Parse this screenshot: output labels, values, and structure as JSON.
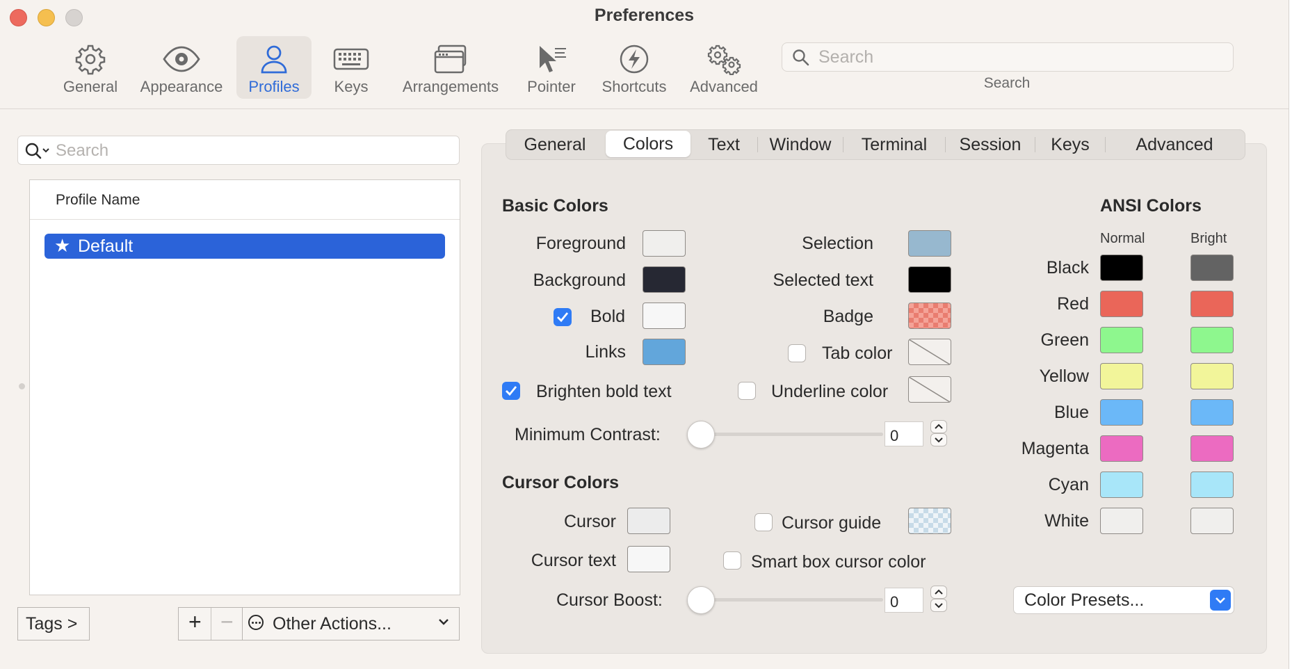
{
  "window": {
    "title": "Preferences"
  },
  "toolbar": {
    "items": [
      {
        "label": "General",
        "icon": "gear-icon"
      },
      {
        "label": "Appearance",
        "icon": "eye-icon"
      },
      {
        "label": "Profiles",
        "icon": "person-icon",
        "active": true
      },
      {
        "label": "Keys",
        "icon": "keyboard-icon"
      },
      {
        "label": "Arrangements",
        "icon": "window-stack-icon"
      },
      {
        "label": "Pointer",
        "icon": "pointer-icon"
      },
      {
        "label": "Shortcuts",
        "icon": "lightning-icon"
      },
      {
        "label": "Advanced",
        "icon": "gears-icon"
      }
    ],
    "search_placeholder": "Search",
    "search_label": "Search"
  },
  "sidebar": {
    "search_placeholder": "Search",
    "list_header": "Profile Name",
    "profiles": [
      {
        "name": "Default",
        "selected": true
      }
    ],
    "tags_button": "Tags >",
    "add_symbol": "+",
    "remove_symbol": "−",
    "other_actions": "Other Actions..."
  },
  "tabs": [
    "General",
    "Colors",
    "Text",
    "Window",
    "Terminal",
    "Session",
    "Keys",
    "Advanced"
  ],
  "active_tab": "Colors",
  "basic_colors": {
    "title": "Basic Colors",
    "foreground": {
      "label": "Foreground",
      "color": "#f0efed"
    },
    "background": {
      "label": "Background",
      "color": "#262833"
    },
    "bold": {
      "label": "Bold",
      "color": "#f7f7f7",
      "checked": true
    },
    "links": {
      "label": "Links",
      "color": "#62a6db"
    },
    "brighten_bold": {
      "label": "Brighten bold text",
      "checked": true
    },
    "selection": {
      "label": "Selection",
      "color": "#97b8cf"
    },
    "selected_text": {
      "label": "Selected text",
      "color": "#000000"
    },
    "badge": {
      "label": "Badge",
      "color": "#e97d70"
    },
    "tab_color": {
      "label": "Tab color",
      "checked": false
    },
    "underline_color": {
      "label": "Underline color",
      "checked": false
    },
    "min_contrast": {
      "label": "Minimum Contrast:",
      "value": "0"
    }
  },
  "cursor_colors": {
    "title": "Cursor Colors",
    "cursor": {
      "label": "Cursor",
      "color": "#ececec"
    },
    "cursor_text": {
      "label": "Cursor text",
      "color": "#f7f7f7"
    },
    "cursor_guide": {
      "label": "Cursor guide",
      "checked": false
    },
    "smart_box": {
      "label": "Smart box cursor color",
      "checked": false
    },
    "cursor_boost": {
      "label": "Cursor Boost:",
      "value": "0"
    }
  },
  "ansi": {
    "title": "ANSI Colors",
    "normal_header": "Normal",
    "bright_header": "Bright",
    "rows": [
      {
        "name": "Black",
        "normal": "#000000",
        "bright": "#636363"
      },
      {
        "name": "Red",
        "normal": "#ea6659",
        "bright": "#ea6659"
      },
      {
        "name": "Green",
        "normal": "#8ef78e",
        "bright": "#8ef78e"
      },
      {
        "name": "Yellow",
        "normal": "#f2f59a",
        "bright": "#f2f59a"
      },
      {
        "name": "Blue",
        "normal": "#6bb8f8",
        "bright": "#6bb8f8"
      },
      {
        "name": "Magenta",
        "normal": "#ec6bc1",
        "bright": "#ec6bc1"
      },
      {
        "name": "Cyan",
        "normal": "#a8e6f9",
        "bright": "#a8e6f9"
      },
      {
        "name": "White",
        "normal": "#f0efed",
        "bright": "#f0efed"
      }
    ],
    "presets": "Color Presets..."
  }
}
